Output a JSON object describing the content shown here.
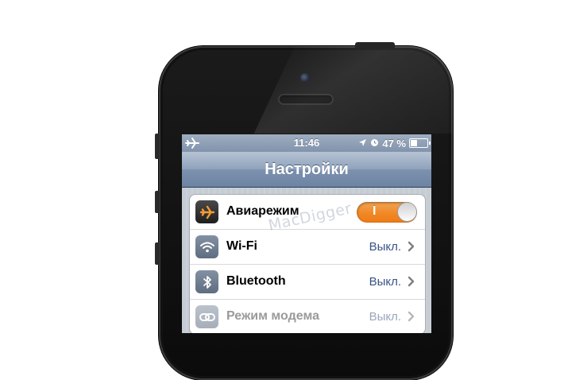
{
  "status_bar": {
    "time": "11:46",
    "battery_percent": "47 %",
    "battery_level": 0.47,
    "icons": [
      "airplane-icon",
      "location-arrow-icon",
      "alarm-clock-icon",
      "battery-icon"
    ]
  },
  "nav_bar": {
    "title": "Настройки"
  },
  "settings": [
    {
      "label": "Авиарежим",
      "icon": "airplane-icon",
      "icon_bg": "#3a3a3a",
      "control": "toggle",
      "toggle_text": "I",
      "toggle_on": true
    },
    {
      "label": "Wi-Fi",
      "icon": "wifi-icon",
      "icon_bg": "#6d7b8d",
      "value": "Выкл."
    },
    {
      "label": "Bluetooth",
      "icon": "bluetooth-icon",
      "icon_bg": "#6d7b8d",
      "value": "Выкл."
    },
    {
      "label": "Режим модема",
      "icon": "chain-link-icon",
      "icon_bg": "#6d7b8d",
      "value": "Выкл.",
      "disabled": true
    }
  ],
  "watermark": "MacDigger",
  "colors": {
    "toggle_accent": "#f18826",
    "value_text": "#385487",
    "nav_bar": "#7c91ae"
  }
}
